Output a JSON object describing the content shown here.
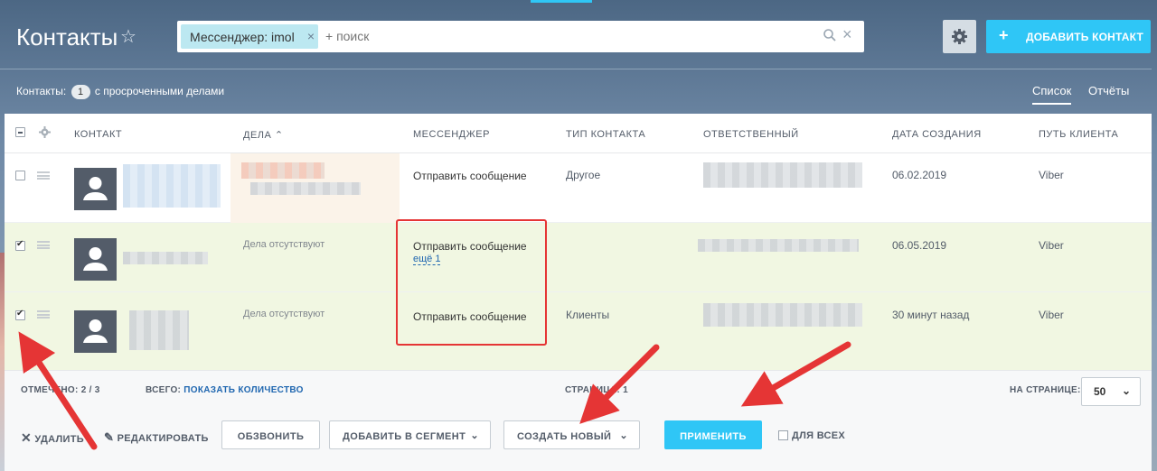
{
  "header": {
    "title": "Контакты",
    "star_icon": "star-icon",
    "filter_chip": "Мессенджер: imol",
    "search_placeholder": "+ поиск",
    "add_button": "ДОБАВИТЬ КОНТАКТ"
  },
  "summary": {
    "prefix": "Контакты:",
    "count": "1",
    "suffix": "с просроченными делами"
  },
  "views": {
    "list": "Список",
    "reports": "Отчёты"
  },
  "columns": [
    "КОНТАКТ",
    "ДЕЛА",
    "МЕССЕНДЖЕР",
    "ТИП КОНТАКТА",
    "ОТВЕТСТВЕННЫЙ",
    "ДАТА СОЗДАНИЯ",
    "ПУТЬ КЛИЕНТА"
  ],
  "rows": [
    {
      "checked": false,
      "deals": "",
      "messenger": "Отправить сообщение",
      "more": "",
      "type": "Другое",
      "created": "06.02.2019",
      "path": "Viber"
    },
    {
      "checked": true,
      "deals": "Дела отсутствуют",
      "messenger": "Отправить сообщение",
      "more": "ещё 1",
      "type": "",
      "created": "06.05.2019",
      "path": "Viber"
    },
    {
      "checked": true,
      "deals": "Дела отсутствуют",
      "messenger": "Отправить сообщение",
      "more": "",
      "type": "Клиенты",
      "created": "30 минут назад",
      "path": "Viber"
    }
  ],
  "footer": {
    "marked": "ОТМЕЧЕНО: 2 / 3",
    "total_label": "ВСЕГО:",
    "total_link": "ПОКАЗАТЬ КОЛИЧЕСТВО",
    "pages": "СТРАНИЦА: 1",
    "per_page_label": "НА СТРАНИЦЕ:",
    "per_page_value": "50"
  },
  "actions": {
    "delete": "УДАЛИТЬ",
    "edit": "РЕДАКТИРОВАТЬ",
    "call": "ОБЗВОНИТЬ",
    "add_segment": "ДОБАВИТЬ В СЕГМЕНТ",
    "create_new": "СОЗДАТЬ НОВЫЙ",
    "apply": "ПРИМЕНИТЬ",
    "for_all": "ДЛЯ ВСЕХ"
  },
  "colors": {
    "accent": "#2fc6f6",
    "selected_row": "#f1f7e2",
    "highlight_box": "#e53535",
    "link": "#2067b0"
  }
}
